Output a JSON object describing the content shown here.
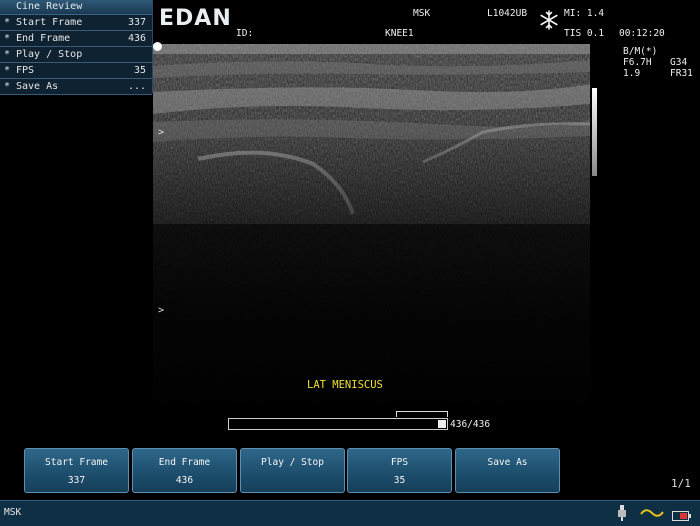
{
  "menu": {
    "title": "Cine Review",
    "items": [
      {
        "star": "*",
        "label": "Start Frame",
        "value": "337"
      },
      {
        "star": "*",
        "label": "End Frame",
        "value": "436"
      },
      {
        "star": "*",
        "label": "Play / Stop",
        "value": ""
      },
      {
        "star": "*",
        "label": "FPS",
        "value": "35"
      },
      {
        "star": "*",
        "label": "Save As",
        "value": "..."
      }
    ]
  },
  "header": {
    "logo": "EDAN",
    "id_label": "ID:",
    "exam_type": "MSK",
    "patient": "KNEE1",
    "probe": "L1042UB",
    "mi": "MI: 1.4",
    "tis": "TIS 0.1",
    "time": "00:12:20",
    "freeze_icon": "snowflake-icon"
  },
  "params": {
    "mode": "B/M(*)",
    "freq": "F6.7H",
    "gain": "G34",
    "depth": "1.9",
    "frame_rate": "FR31"
  },
  "image": {
    "annotation": "LAT MENISCUS",
    "focus_marker_1": ">",
    "focus_marker_2": ">"
  },
  "cine": {
    "current_frame": 436,
    "total_frames": 436,
    "counter": "436/436"
  },
  "softkeys": [
    {
      "line1": "Start Frame",
      "line2": "337"
    },
    {
      "line1": "End Frame",
      "line2": "436"
    },
    {
      "line1": "Play / Stop",
      "line2": ""
    },
    {
      "line1": "FPS",
      "line2": "35"
    },
    {
      "line1": "Save As",
      "line2": ""
    }
  ],
  "page_indicator": "1/1",
  "status": {
    "mode": "MSK",
    "icons": [
      "probe-connection-icon",
      "trackball-icon",
      "battery-icon"
    ],
    "trackball_color": "#e6c21a"
  }
}
